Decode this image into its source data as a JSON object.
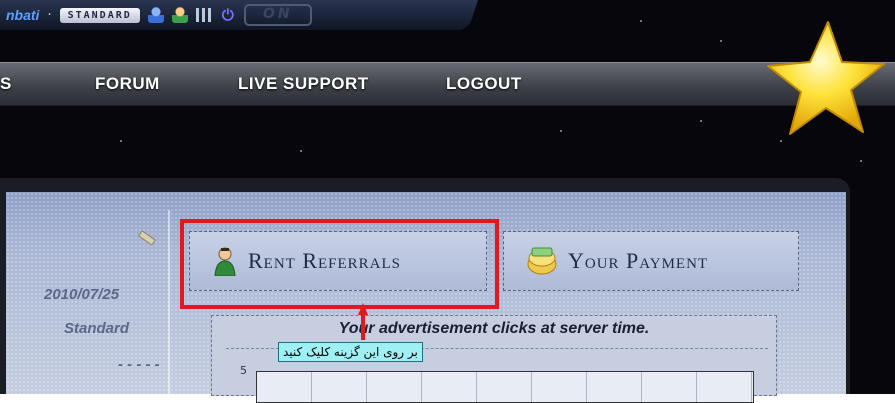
{
  "topbar": {
    "username": "nbati",
    "separator": "·",
    "membership": "STANDARD",
    "online_status": "ON",
    "icons": [
      "user-blue-icon",
      "user-green-icon",
      "stats-icon",
      "power-icon"
    ]
  },
  "nav": {
    "partial_item": "S",
    "items": [
      "FORUM",
      "LIVE SUPPORT",
      "LOGOUT"
    ]
  },
  "left_panel": {
    "date": "2010/07/25",
    "membership": "Standard",
    "dashes": "- - - - -"
  },
  "tabs": {
    "rent_referrals": "Rent Referrals",
    "your_payment": "Your Payment"
  },
  "chart": {
    "title": "Your advertisement clicks at server time.",
    "y_tick": "5"
  },
  "annotation": {
    "text": "بر روی این گزینه کلیک کنید"
  },
  "colors": {
    "highlight": "#e2171f",
    "annotation_bg": "#9ff0f5"
  }
}
